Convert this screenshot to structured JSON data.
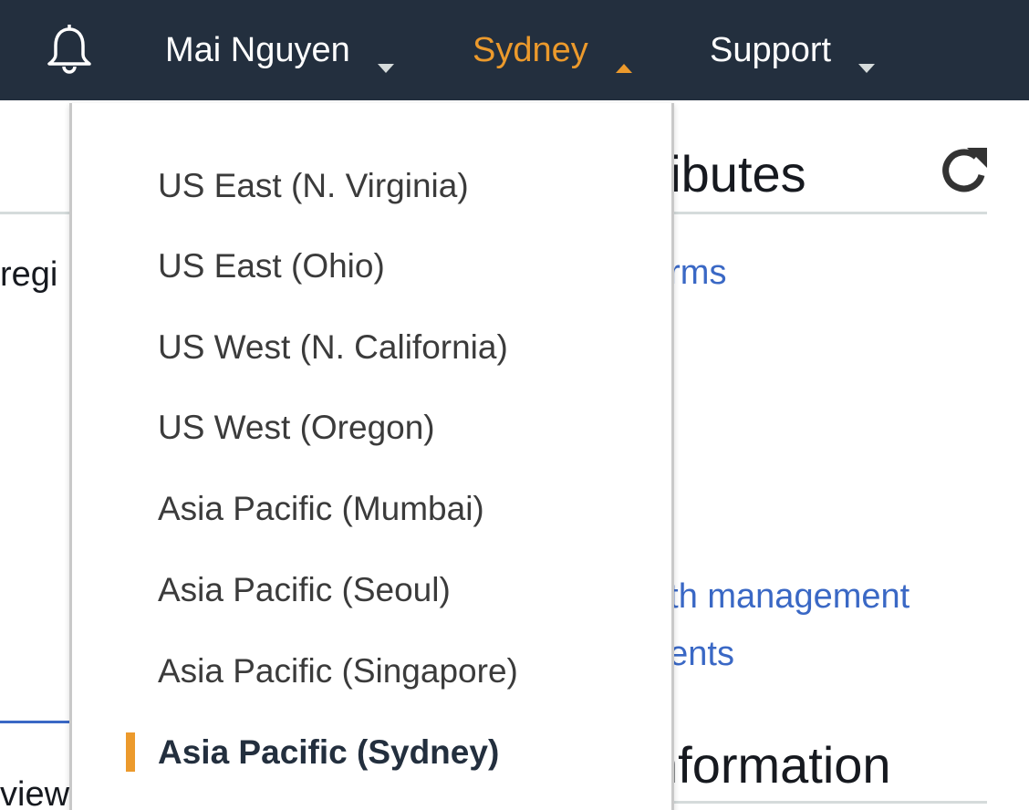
{
  "topbar": {
    "user_name": "Mai Nguyen",
    "region": "Sydney",
    "support": "Support",
    "icons": {
      "notifications": "bell-icon",
      "caret": "caret-down-icon",
      "caret_open": "caret-up-icon"
    },
    "colors": {
      "background": "#232f3e",
      "accent": "#ec9a2c"
    }
  },
  "background": {
    "heading_attributes": "tributes",
    "left_cut_text": "regi",
    "link_forms": "orms",
    "link_length_mgmt": "gth management",
    "link_ments": "nents",
    "heading_information": "nformation",
    "bottom_left_text": "view"
  },
  "region_menu": {
    "items": [
      "US East (N. Virginia)",
      "US East (Ohio)",
      "US West (N. California)",
      "US West (Oregon)",
      "Asia Pacific (Mumbai)",
      "Asia Pacific (Seoul)",
      "Asia Pacific (Singapore)",
      "Asia Pacific (Sydney)"
    ],
    "selected": "Asia Pacific (Sydney)"
  }
}
